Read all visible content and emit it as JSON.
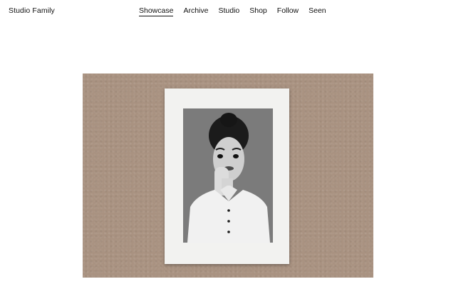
{
  "header": {
    "brand": "Studio Family",
    "nav": [
      {
        "label": "Showcase",
        "active": true
      },
      {
        "label": "Archive",
        "active": false
      },
      {
        "label": "Studio",
        "active": false
      },
      {
        "label": "Shop",
        "active": false
      },
      {
        "label": "Follow",
        "active": false
      },
      {
        "label": "Seen",
        "active": false
      }
    ]
  },
  "showcase": {
    "colors": {
      "stage_background": "#a99281",
      "card_background": "#f2f2f0",
      "photo_background": "#7f7f7f"
    }
  }
}
